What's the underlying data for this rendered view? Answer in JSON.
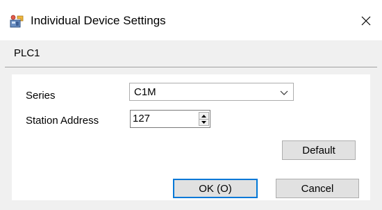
{
  "window": {
    "title": "Individual Device Settings",
    "icon": "device-settings-icon",
    "close_icon": "close-icon"
  },
  "device_name": "PLC1",
  "form": {
    "series_label": "Series",
    "series_value": "C1M",
    "station_label": "Station Address",
    "station_value": "127"
  },
  "buttons": {
    "default_label": "Default",
    "ok_label": "OK (O)",
    "cancel_label": "Cancel"
  },
  "colors": {
    "accent": "#0078d7",
    "button_bg": "#e1e1e1",
    "dialog_bg": "#f0f0f0"
  }
}
